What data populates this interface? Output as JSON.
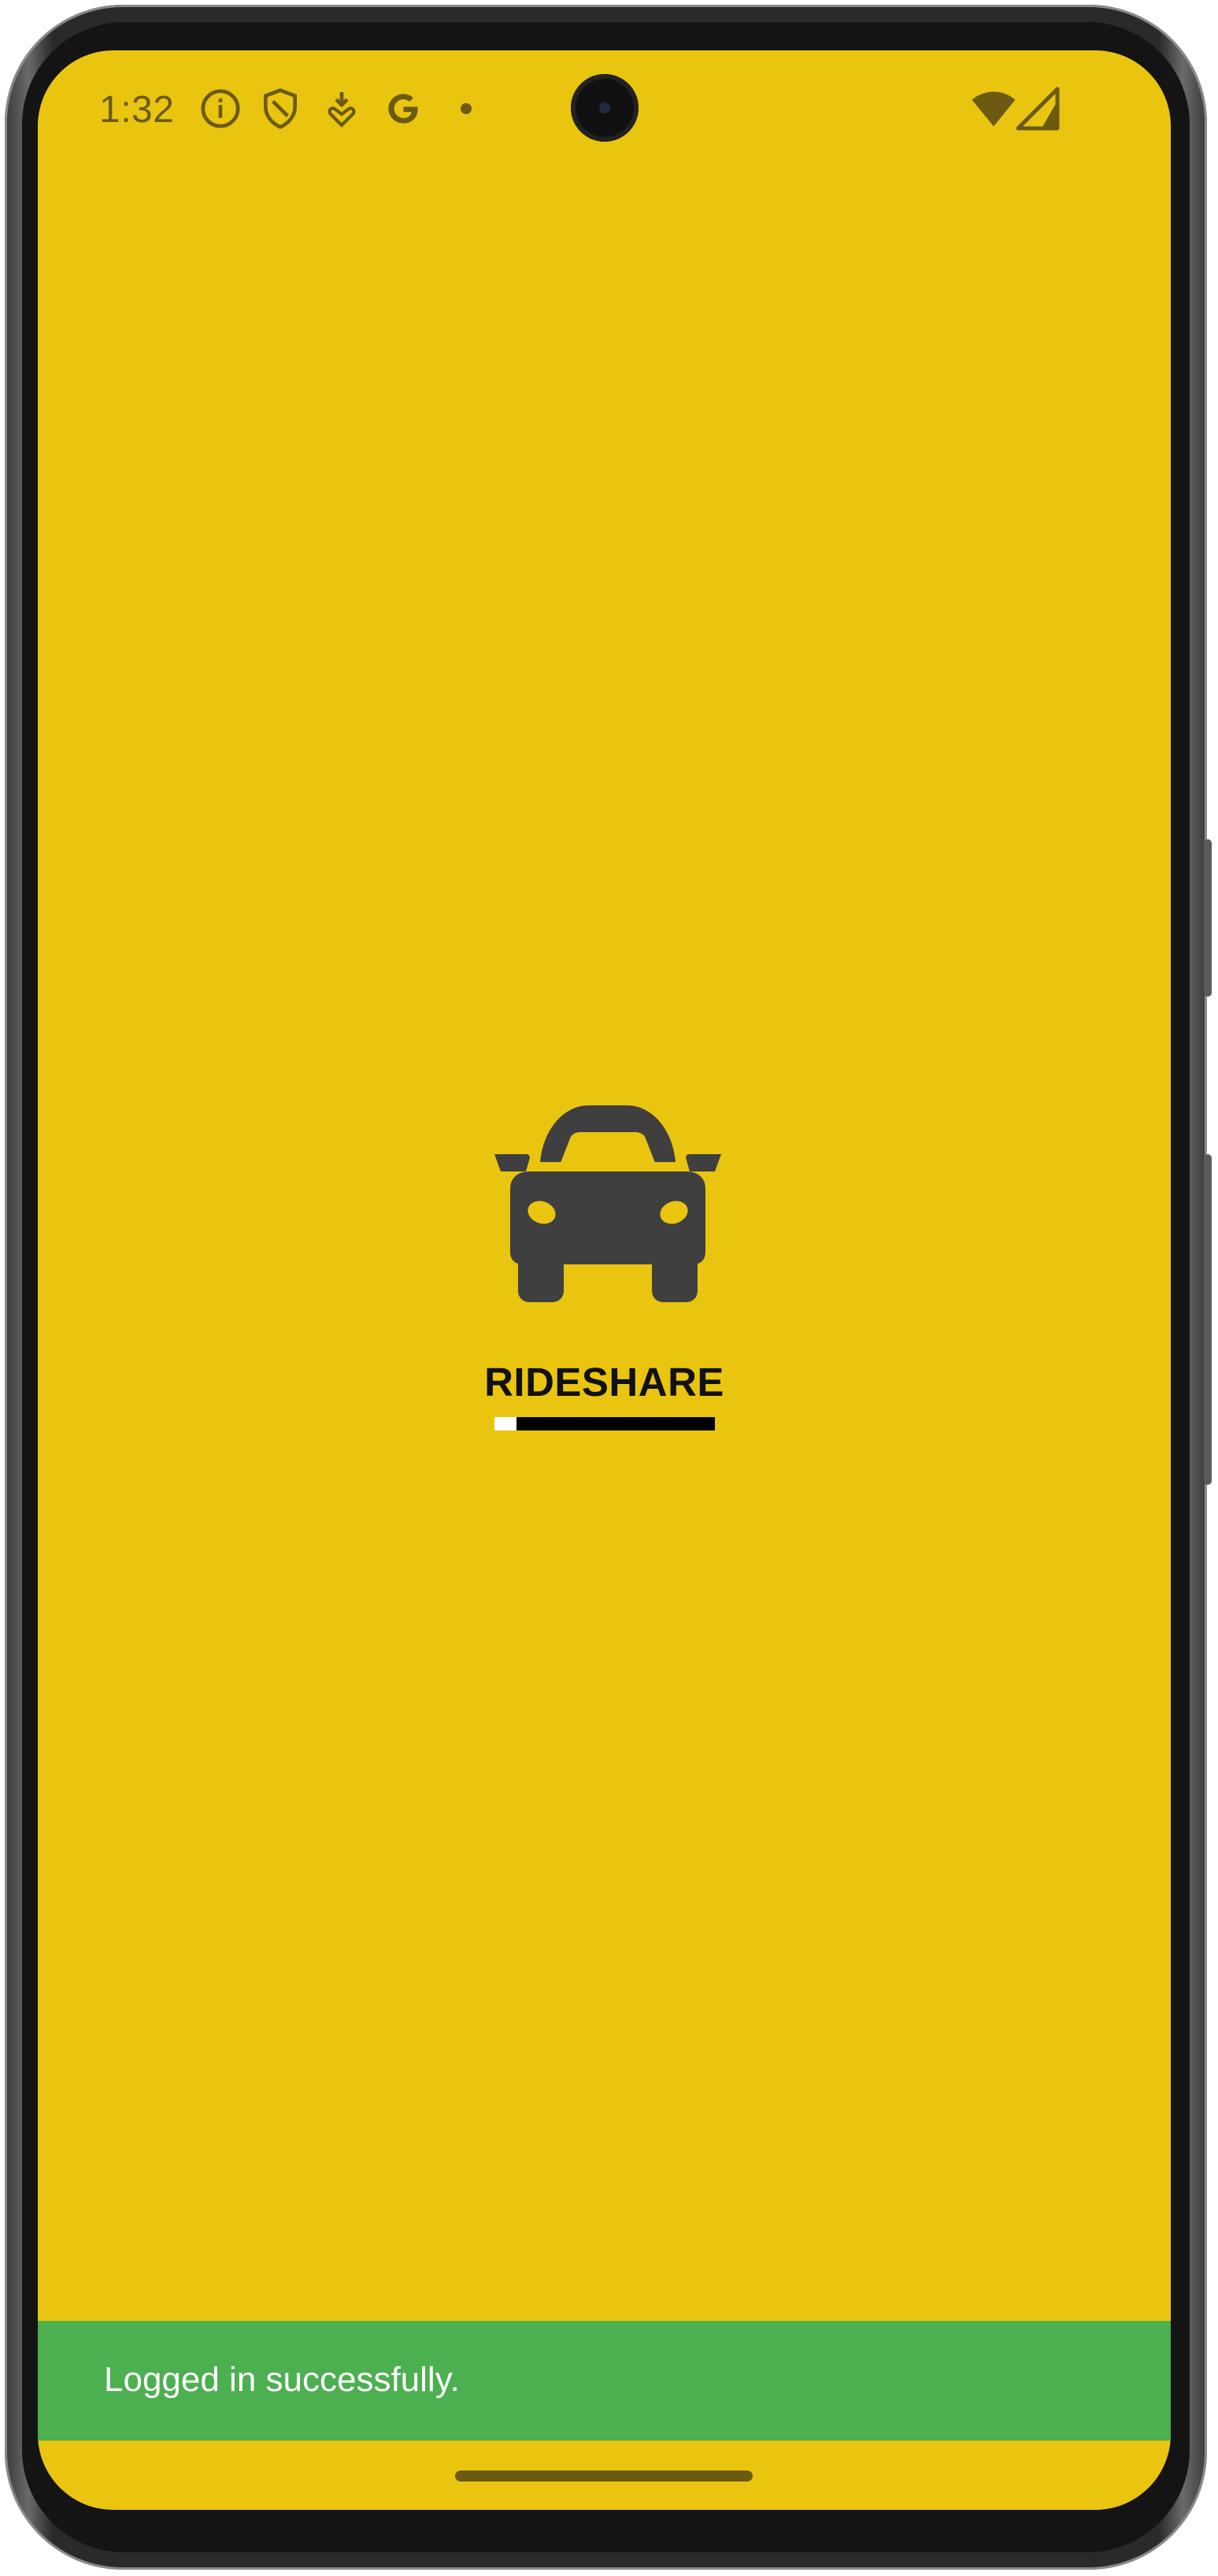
{
  "status_bar": {
    "time": "1:32",
    "icons": [
      "info-icon",
      "shield-icon",
      "download-heart-icon",
      "google-icon",
      "dot-icon",
      "wifi-icon",
      "signal-icon"
    ]
  },
  "splash": {
    "logo_icon": "car-icon",
    "brand_text": "RIDESHARE",
    "loading_progress": 0.1
  },
  "snackbar": {
    "message": "Logged in successfully."
  },
  "colors": {
    "background": "#EAC510",
    "snackbar": "#4CAF50",
    "logo": "#3f3f3f"
  }
}
